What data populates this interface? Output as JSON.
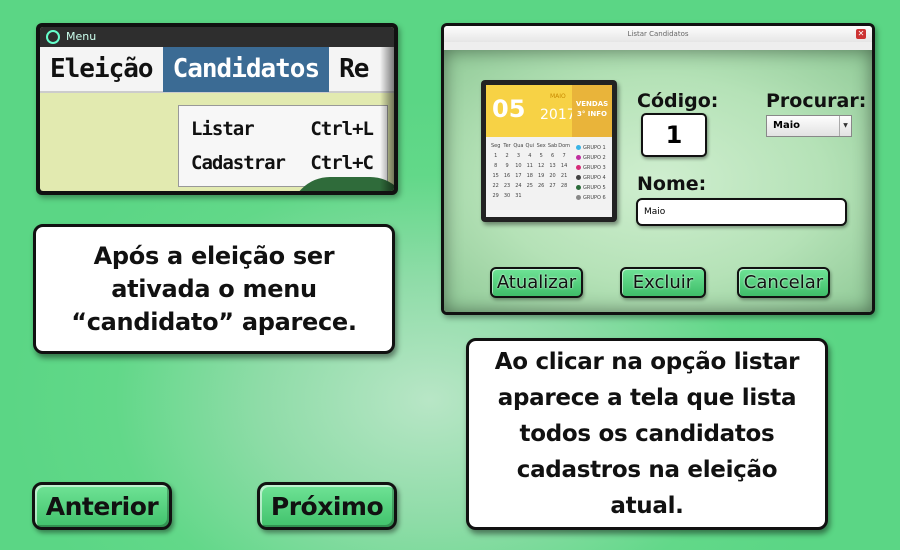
{
  "menu_screenshot": {
    "window_title": "Menu",
    "menubar": [
      "Eleição",
      "Candidatos",
      "Re"
    ],
    "dropdown": [
      {
        "label": "Listar",
        "shortcut": "Ctrl+L"
      },
      {
        "label": "Cadastrar",
        "shortcut": "Ctrl+C"
      }
    ]
  },
  "info_left": "Após a eleição ser ativada o menu “candidato” aparece.",
  "info_right": "Ao clicar na opção listar aparece a tela que lista todos os candidatos cadastros na eleição atual.",
  "nav": {
    "previous": "Anterior",
    "next": "Próximo"
  },
  "window_screenshot": {
    "title": "Listar Candidatos",
    "calendar": {
      "day": "05",
      "month": "MAIO",
      "year": "2017",
      "side_text_1": "VENDAS",
      "side_text_2": "3° INFO",
      "weekdays": [
        "Seg",
        "Ter",
        "Qua",
        "Qui",
        "Sex",
        "Sab",
        "Dom"
      ],
      "days": [
        "1",
        "2",
        "3",
        "4",
        "5",
        "6",
        "7",
        "8",
        "9",
        "10",
        "11",
        "12",
        "13",
        "14",
        "15",
        "16",
        "17",
        "18",
        "19",
        "20",
        "21",
        "22",
        "23",
        "24",
        "25",
        "26",
        "27",
        "28",
        "29",
        "30",
        "31"
      ],
      "legend": [
        "GRUPO 1",
        "GRUPO 2",
        "GRUPO 3",
        "GRUPO 4",
        "GRUPO 5",
        "GRUPO 6"
      ],
      "legend_colors": [
        "#3ab4e6",
        "#c02ea0",
        "#d62c77",
        "#444444",
        "#2b6b3a",
        "#888888"
      ]
    },
    "codigo_label": "Código:",
    "codigo_value": "1",
    "procurar_label": "Procurar:",
    "procurar_value": "Maio",
    "nome_label": "Nome:",
    "nome_value": "Maio",
    "buttons": {
      "update": "Atualizar",
      "delete": "Excluir",
      "cancel": "Cancelar"
    }
  }
}
